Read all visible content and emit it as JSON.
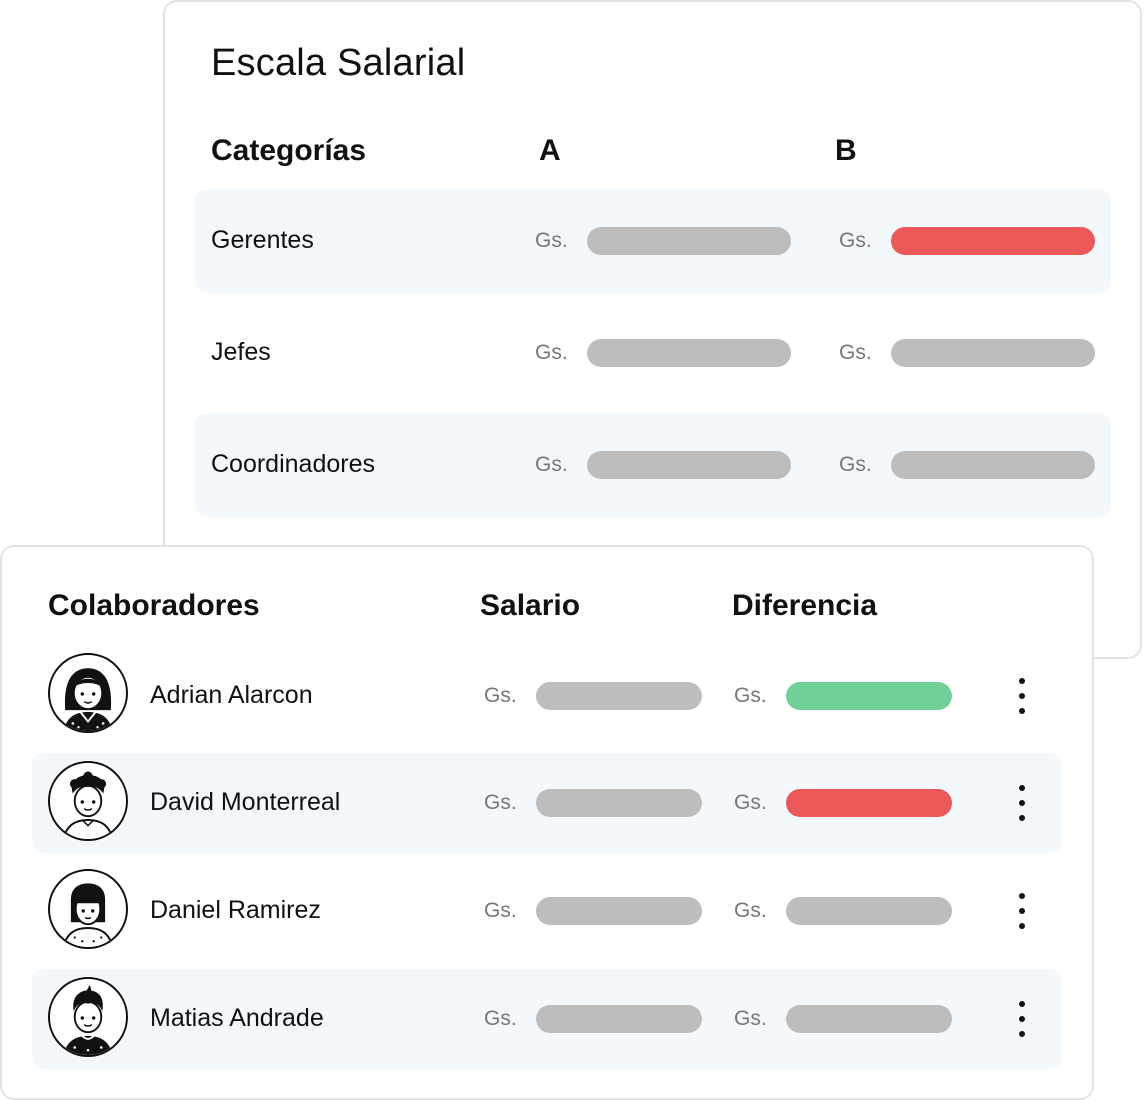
{
  "colors": {
    "bar_neutral": "#bdbdbd",
    "bar_alert": "#ec5757",
    "bar_positive": "#70d097",
    "row_shade": "#f3f8fd"
  },
  "scale": {
    "title": "Escala Salarial",
    "headers": {
      "category": "Categorías",
      "col_a": "A",
      "col_b": "B"
    },
    "currency": "Gs.",
    "rows": [
      {
        "label": "Gerentes",
        "a_status": "neutral",
        "b_status": "alert"
      },
      {
        "label": "Jefes",
        "a_status": "neutral",
        "b_status": "neutral"
      },
      {
        "label": "Coordinadores",
        "a_status": "neutral",
        "b_status": "neutral"
      }
    ]
  },
  "collaborators": {
    "headers": {
      "name": "Colaboradores",
      "salary": "Salario",
      "difference": "Diferencia"
    },
    "currency": "Gs.",
    "menu_icon": "kebab-menu-icon",
    "rows": [
      {
        "name": "Adrian Alarcon",
        "avatar": "avatar-long-hair-icon",
        "salary_status": "neutral",
        "difference_status": "positive"
      },
      {
        "name": "David Monterreal",
        "avatar": "avatar-curly-hair-icon",
        "salary_status": "neutral",
        "difference_status": "alert"
      },
      {
        "name": "Daniel Ramirez",
        "avatar": "avatar-bob-hair-icon",
        "salary_status": "neutral",
        "difference_status": "neutral"
      },
      {
        "name": "Matias Andrade",
        "avatar": "avatar-short-hair-icon",
        "salary_status": "neutral",
        "difference_status": "neutral"
      }
    ]
  }
}
